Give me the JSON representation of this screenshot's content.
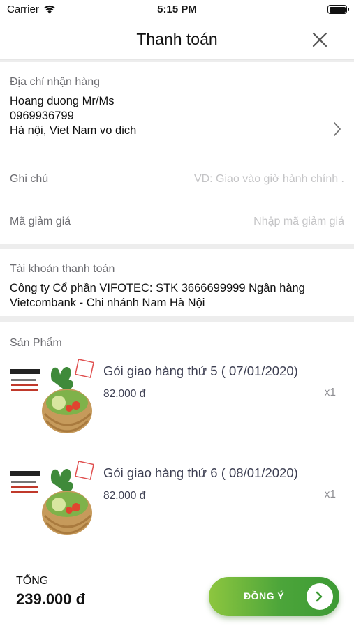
{
  "status": {
    "carrier": "Carrier",
    "time": "5:15 PM"
  },
  "nav": {
    "title": "Thanh toán"
  },
  "address": {
    "label": "Địa chỉ nhận hàng",
    "name": "Hoang duong Mr/Ms",
    "phone": "0969936799",
    "location": "Hà nội, Viet Nam vo dich"
  },
  "note": {
    "label": "Ghi chú",
    "placeholder": "VD: Giao vào giờ hành chính ."
  },
  "discount": {
    "label": "Mã giảm giá",
    "placeholder": "Nhập mã giảm giá"
  },
  "account": {
    "label": "Tài khoản thanh toán",
    "text": "Công ty Cổ phần VIFOTEC: STK 3666699999 Ngân hàng Vietcombank - Chi nhánh Nam Hà Nội"
  },
  "products": {
    "label": "Sản Phẩm",
    "items": [
      {
        "name": "Gói giao hàng thứ 5 ( 07/01/2020)",
        "price": "82.000 đ",
        "qty": "x1"
      },
      {
        "name": "Gói giao hàng thứ 6 ( 08/01/2020)",
        "price": "82.000 đ",
        "qty": "x1"
      }
    ]
  },
  "footer": {
    "total_label": "TỔNG",
    "total_value": "239.000 đ",
    "confirm_label": "ĐỒNG Ý"
  },
  "colors": {
    "accent_green": "#4ca53a",
    "text_muted": "#6d6d72",
    "placeholder": "#c4c4c6"
  }
}
